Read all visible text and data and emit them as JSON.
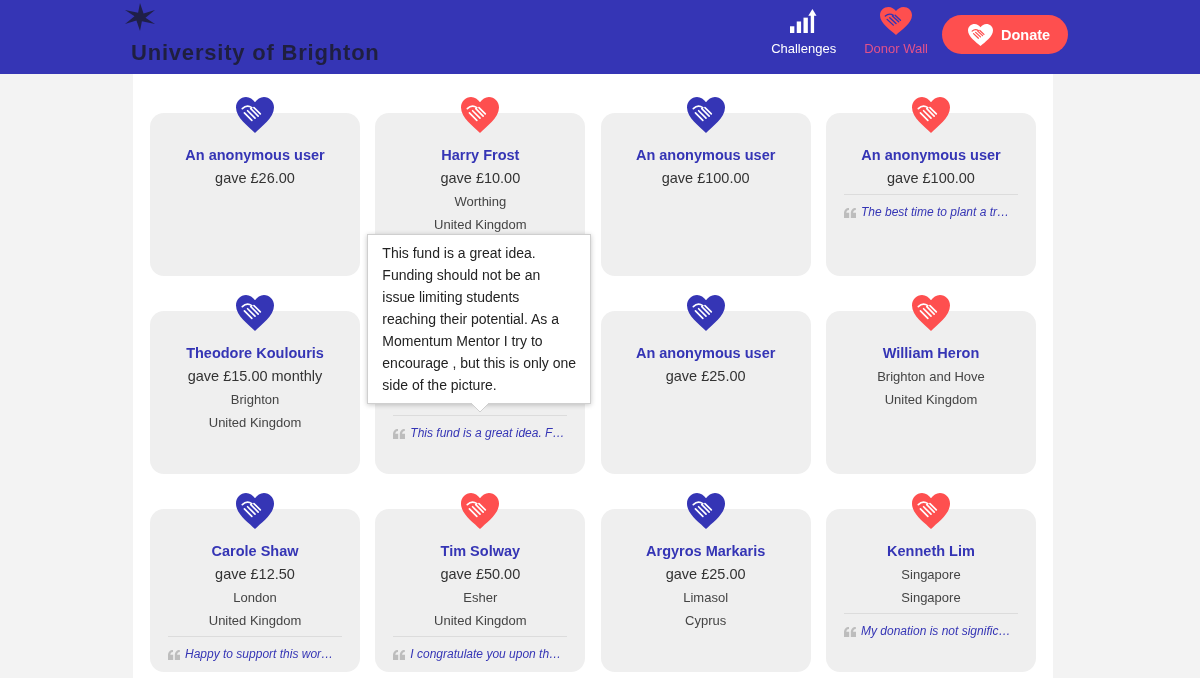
{
  "header": {
    "logo_text": "University of Brighton",
    "nav": [
      {
        "label": "Challenges",
        "selected": false
      },
      {
        "label": "Donor Wall",
        "selected": true
      }
    ],
    "donate_button": {
      "label": "Donate"
    }
  },
  "cards": [
    {
      "name": "An anonymous user",
      "amount": "gave £26.00",
      "color": "#3535b5"
    },
    {
      "name": "Harry Frost",
      "amount": "gave £10.00",
      "city": "Worthing",
      "country": "United Kingdom",
      "color": "#fe4f4f"
    },
    {
      "name": "An anonymous user",
      "amount": "gave £100.00",
      "color": "#3535b5"
    },
    {
      "name": "An anonymous user",
      "amount": "gave £100.00",
      "message": "The best time to plant a tr…",
      "color": "#fe4f4f"
    },
    {
      "name": "Theodore Koulouris",
      "amount": "gave £15.00 monthly",
      "city": "Brighton",
      "country": "United Kingdom",
      "color": "#3535b5"
    },
    {
      "message": "This fund is a great idea. F…",
      "tooltip": "This fund is a great idea. Funding should not be an issue limiting students reaching their potential. As a Momentum Mentor I try to encourage , but this is only one side of the picture."
    },
    {
      "name": "An anonymous user",
      "amount": "gave £25.00",
      "color": "#3535b5"
    },
    {
      "name": "William Heron",
      "city": "Brighton and Hove",
      "country": "United Kingdom",
      "color": "#fe4f4f"
    },
    {
      "name": "Carole Shaw",
      "amount": "gave £12.50",
      "city": "London",
      "country": "United Kingdom",
      "message": "Happy to support this wor…",
      "color": "#3535b5"
    },
    {
      "name": "Tim Solway",
      "amount": "gave £50.00",
      "city": "Esher",
      "country": "United Kingdom",
      "message": "I congratulate you upon th…",
      "color": "#fe4f4f"
    },
    {
      "name": "Argyros Markaris",
      "amount": "gave £25.00",
      "city": "Limasol",
      "country": "Cyprus",
      "color": "#3535b5"
    },
    {
      "name": "Kenneth Lim",
      "city": "Singapore",
      "country": "Singapore",
      "message": "My donation is not signific…",
      "color": "#fe4f4f"
    }
  ]
}
